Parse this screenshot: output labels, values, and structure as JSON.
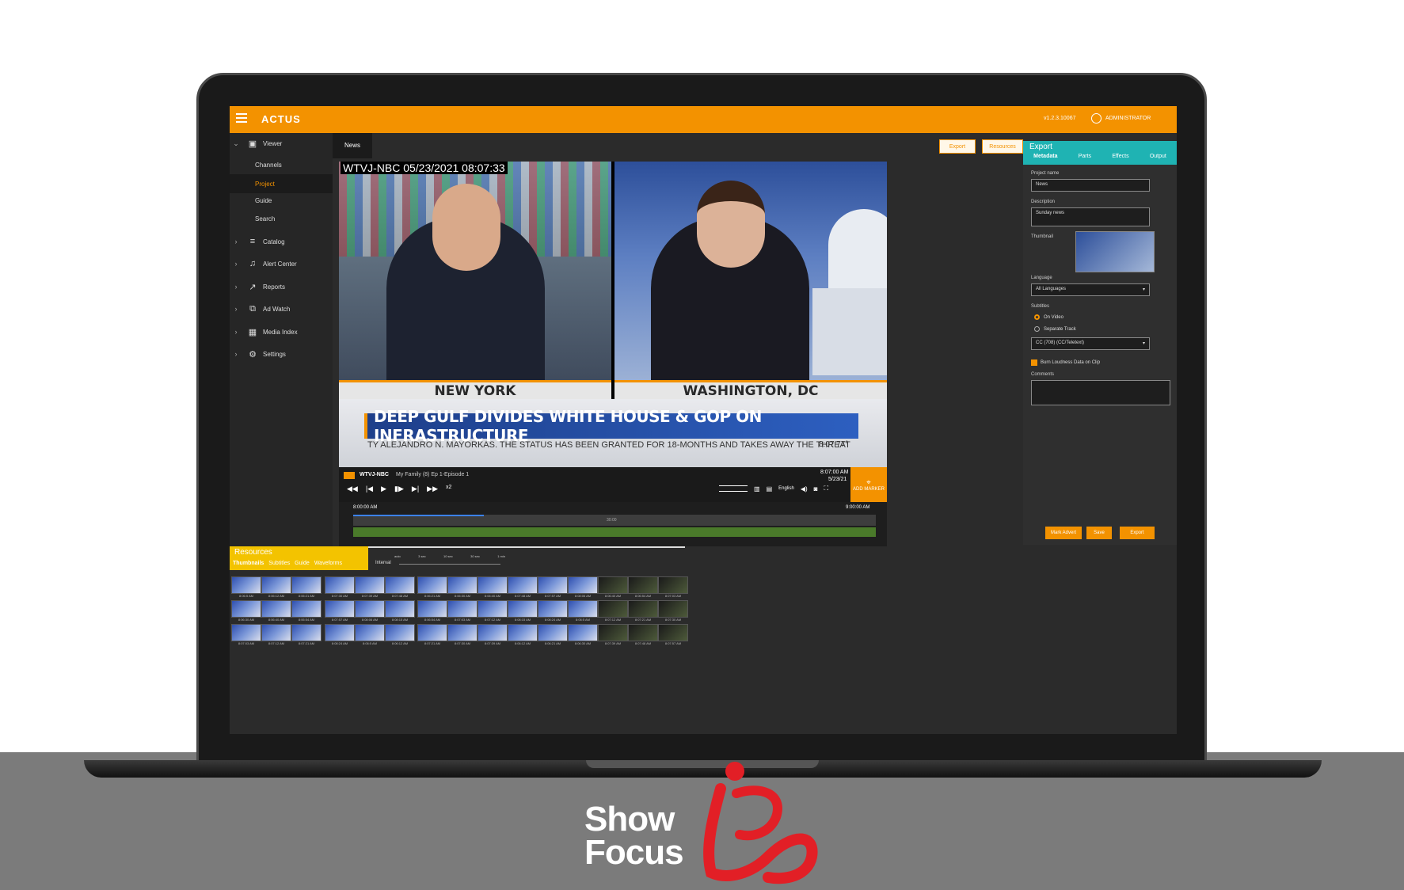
{
  "app": {
    "name": "ACTUS",
    "version": "v1.2.3.10067",
    "user": "ADMINISTRATOR"
  },
  "sidebar": {
    "viewer": "Viewer",
    "viewer_items": [
      "Channels",
      "Project",
      "Guide",
      "Search"
    ],
    "items": [
      {
        "label": "Catalog",
        "icon": "list-icon"
      },
      {
        "label": "Alert Center",
        "icon": "bell-icon"
      },
      {
        "label": "Reports",
        "icon": "chart-icon"
      },
      {
        "label": "Ad Watch",
        "icon": "ad-icon"
      },
      {
        "label": "Media Index",
        "icon": "media-icon"
      },
      {
        "label": "Settings",
        "icon": "gear-icon"
      }
    ]
  },
  "tabs": {
    "news": "News",
    "export": "Export",
    "resources": "Resources"
  },
  "video": {
    "stamp": "WTVJ-NBC  05/23/2021 08:07:33",
    "left_location": "NEW YORK",
    "right_location": "WASHINGTON, DC",
    "headline": "DEEP GULF DIVIDES WHITE HOUSE & GOP ON INFRASTRUCTURE",
    "ticker": "TY ALEJANDRO N. MAYORKAS. THE STATUS HAS BEEN GRANTED FOR 18-MONTHS AND TAKES AWAY THE THREAT",
    "clock": "8:07  77°"
  },
  "transport": {
    "channel": "WTVJ-NBC",
    "program": "My Family (8) Ep 1-Episode 1",
    "time": "8:07:00 AM",
    "date": "5/23/21",
    "speed": "x2",
    "language": "English",
    "add_marker": "ADD MARKER",
    "start": "8:00:00 AM",
    "end": "9:00:00 AM",
    "mid": "30:00"
  },
  "export": {
    "title": "Export",
    "tabs": [
      "Metadata",
      "Parts",
      "Effects",
      "Output"
    ],
    "project_name_label": "Project name",
    "project_name": "News",
    "description_label": "Description",
    "description": "Sunday news",
    "thumbnail_label": "Thumbnail",
    "language_label": "Language",
    "language": "All Languages",
    "subtitles_label": "Subtitles",
    "subtitle_opt1": "On Video",
    "subtitle_opt2": "Separate Track",
    "cc": "CC (708) (CC/Teletext)",
    "burn": "Burn Loudness Data on Clip",
    "comments_label": "Comments",
    "mark_advert": "Mark Advert",
    "save": "Save",
    "export_btn": "Export"
  },
  "resources": {
    "title": "Resources",
    "tabs": [
      "Thumbnails",
      "Subtitles",
      "Guide",
      "Waveforms"
    ],
    "interval_label": "Interval",
    "intervals": [
      "auto",
      "3 sec",
      "10 sec",
      "30 sec",
      "1 min"
    ],
    "captions": [
      "8:06:5 AM",
      "8:06:12 AM",
      "8:06:21 AM",
      "8:06:30 AM",
      "8:06:40 AM",
      "8:06:54 AM",
      "8:07:03 AM",
      "8:07:12 AM",
      "8:07:21 AM",
      "8:07:30 AM",
      "8:07:39 AM",
      "8:07:48 AM",
      "8:07:57 AM",
      "8:08:06 AM",
      "8:08:15 AM",
      "8:08:24 AM"
    ]
  },
  "branding": {
    "line1": "Show",
    "line2": "Focus"
  },
  "colors": {
    "accent": "#f39200",
    "teal": "#1fb3b3",
    "ibc_red": "#e21f26"
  }
}
